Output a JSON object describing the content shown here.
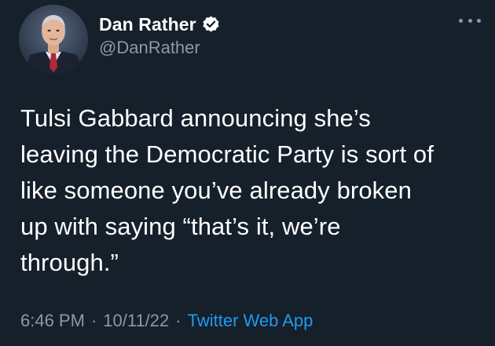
{
  "author": {
    "display_name": "Dan Rather",
    "handle": "@DanRather",
    "verified": true
  },
  "tweet": {
    "text": "Tulsi Gabbard announcing she’s\nleaving the Democratic Party is sort of\nlike someone you’ve already broken\nup with saying “that’s it, we’re\nthrough.”",
    "time": "6:46 PM",
    "date": "10/11/22",
    "separator": "·",
    "source": "Twitter Web App"
  },
  "colors": {
    "background": "#15202b",
    "primary_text": "#ffffff",
    "secondary_text": "#8b98a5",
    "accent": "#1d9bf0"
  },
  "icons": {
    "verified": "verified-badge-icon",
    "more": "more-options-icon"
  }
}
